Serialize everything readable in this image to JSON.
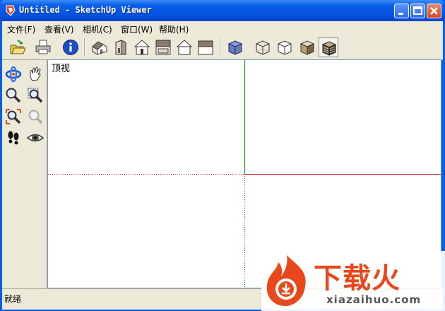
{
  "window": {
    "title": "Untitled - SketchUp Viewer"
  },
  "menu": [
    {
      "label": "文件(F)"
    },
    {
      "label": "查看(V)"
    },
    {
      "label": "相机(C)"
    },
    {
      "label": "窗口(W)"
    },
    {
      "label": "帮助(H)"
    }
  ],
  "toolbar": {
    "icons": [
      "open-file-icon",
      "print-icon",
      "model-info-icon",
      "iso-view-icon",
      "right-view-icon",
      "front-view-icon",
      "top-view-icon",
      "back-view-icon",
      "left-view-icon",
      "xray-icon",
      "wireframe-icon",
      "hidden-line-icon",
      "shaded-icon",
      "shaded-textures-icon"
    ],
    "pressed": "shaded-textures-icon"
  },
  "palette": {
    "icons": [
      "orbit-icon",
      "pan-icon",
      "zoom-icon",
      "zoom-window-icon",
      "zoom-extents-icon",
      "previous-view-icon",
      "walk-icon",
      "look-around-icon"
    ]
  },
  "viewport": {
    "label": "顶视"
  },
  "status": {
    "text": "就绪"
  },
  "watermark": {
    "brand": "下载火",
    "domain": "xiazaihuo.com"
  },
  "colors": {
    "title_blue": "#0a5de8",
    "chrome": "#ece9d8",
    "axis_green": "#00a000",
    "axis_red": "#c00000",
    "watermark_orange": "#e8481c"
  }
}
